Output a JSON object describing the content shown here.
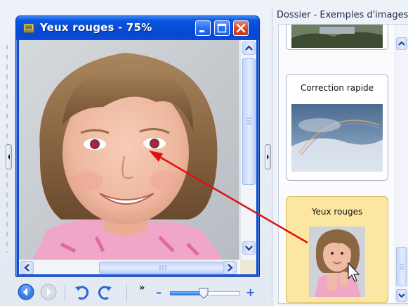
{
  "window": {
    "title": "Yeux rouges  - 75%",
    "title_icon": "photo-app-icon",
    "controls": [
      "minimize-icon",
      "maximize-icon",
      "close-icon"
    ]
  },
  "folder_panel": {
    "title": "Dossier - Exemples d'images",
    "items": [
      {
        "label": "",
        "kind": "partial-landscape"
      },
      {
        "label": "Correction rapide",
        "kind": "sky-rainbow"
      },
      {
        "label": "Yeux rouges",
        "kind": "girl-portrait",
        "selected": true
      }
    ]
  },
  "toolbar": {
    "buttons": [
      "back-icon",
      "forward-icon",
      "rotate-left-icon",
      "rotate-right-icon"
    ],
    "more_label": "»",
    "zoom_minus": "–",
    "zoom_plus": "+",
    "zoom_level": 0.48
  },
  "colors": {
    "titlebar": "#0a4bd8",
    "selected_card": "#fbe7a1",
    "annotation_arrow": "#e01010"
  }
}
